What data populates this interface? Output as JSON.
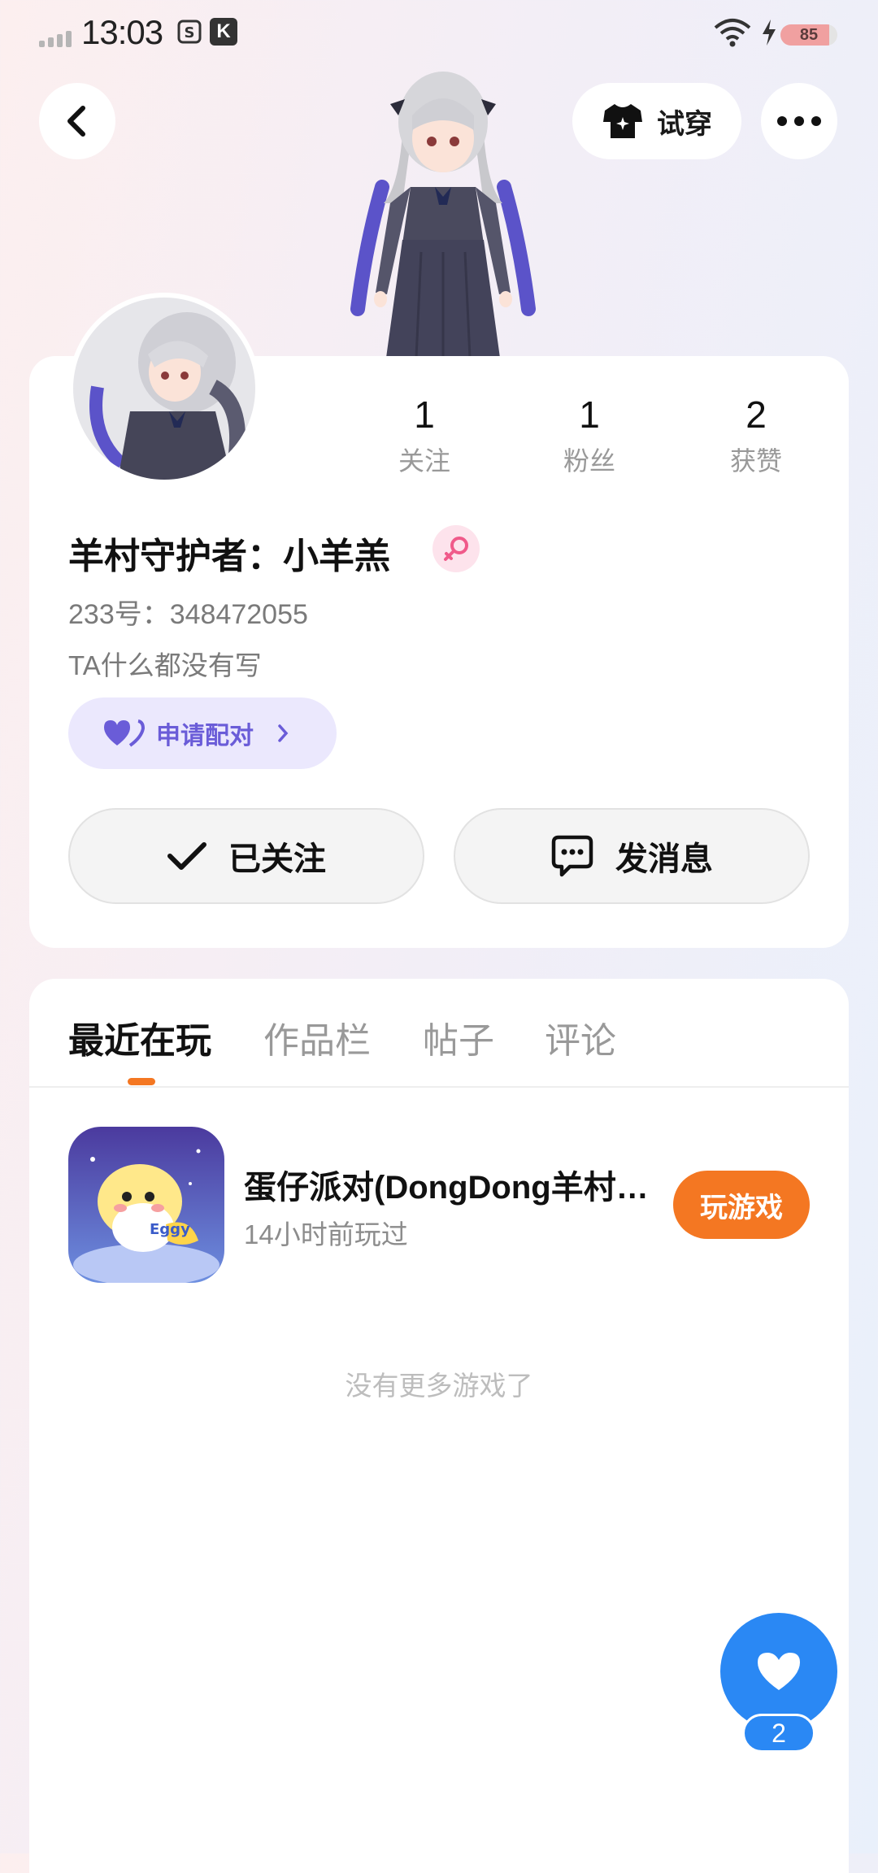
{
  "status_bar": {
    "time": "13:03",
    "battery": "85",
    "battery_level": 0.85
  },
  "header": {
    "tryon_label": "试穿"
  },
  "profile": {
    "stats": [
      {
        "num": "1",
        "label": "关注"
      },
      {
        "num": "1",
        "label": "粉丝"
      },
      {
        "num": "2",
        "label": "获赞"
      }
    ],
    "nickname": "羊村守护者：小羊羔",
    "uid": "233号：348472055",
    "bio": "TA什么都没有写",
    "pair_label": "申请配对",
    "follow_label": "已关注",
    "message_label": "发消息"
  },
  "tabs": [
    {
      "label": "最近在玩",
      "active": true
    },
    {
      "label": "作品栏",
      "active": false
    },
    {
      "label": "帖子",
      "active": false
    },
    {
      "label": "评论",
      "active": false
    }
  ],
  "games": [
    {
      "title": "蛋仔派对(DongDong羊村守护者)",
      "last_played": "14小时前玩过",
      "action": "玩游戏"
    }
  ],
  "empty_text": "没有更多游戏了",
  "like_count": "2",
  "colors": {
    "accent": "#f47722",
    "like": "#2a88f4",
    "pair": "#6a5cd8"
  }
}
